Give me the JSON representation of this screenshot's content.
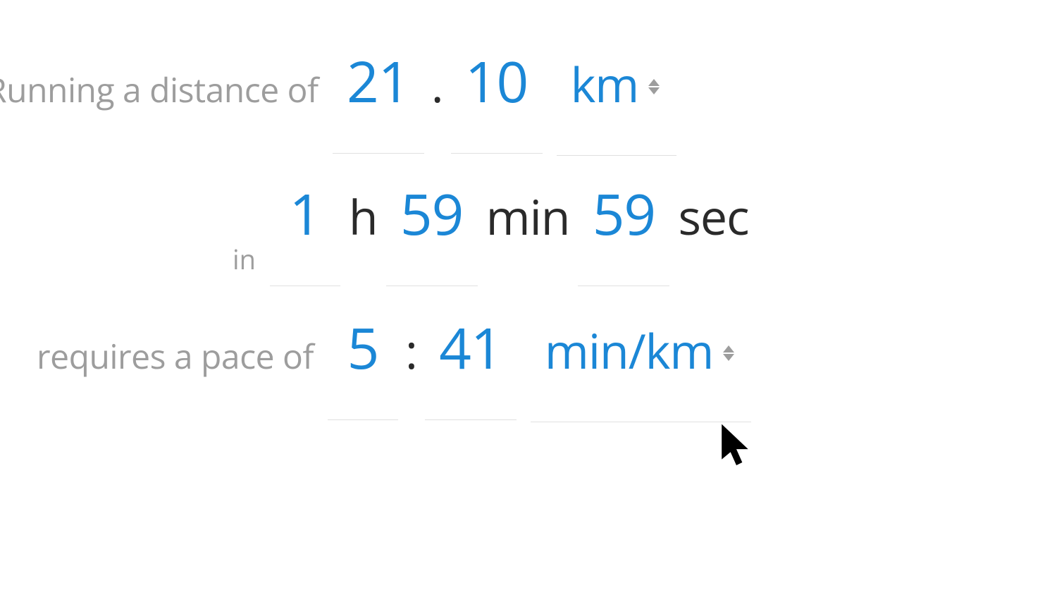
{
  "distance": {
    "label": "Running a distance of",
    "whole": "21",
    "decimal": "10",
    "separator": ".",
    "unit": "km"
  },
  "time": {
    "label": "in",
    "hours": "1",
    "hours_unit": "h",
    "minutes": "59",
    "minutes_unit": "min",
    "seconds": "59",
    "seconds_unit": "sec"
  },
  "pace": {
    "label": "requires a pace of",
    "minutes": "5",
    "separator": ":",
    "seconds": "41",
    "unit": "min/km"
  }
}
